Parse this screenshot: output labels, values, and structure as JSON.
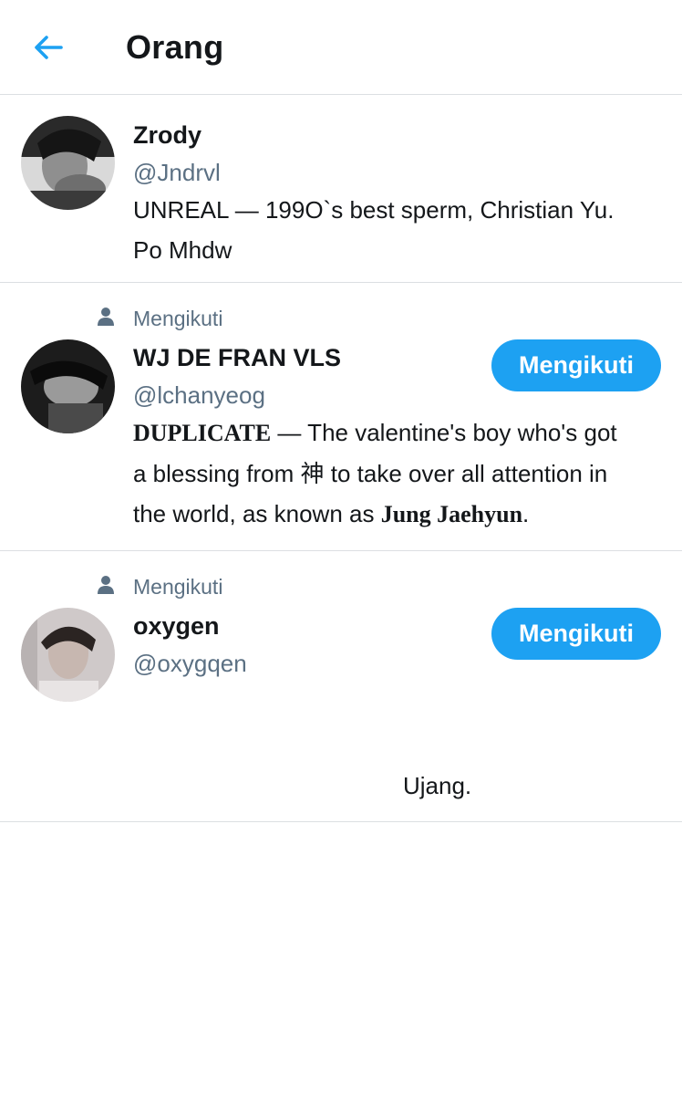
{
  "header": {
    "title": "Orang",
    "back_icon": "arrow-left-icon",
    "accent_color": "#1da1f2"
  },
  "users": [
    {
      "name": "Zrody",
      "handle": "@Jndrvl",
      "bio_line1": "UNREAL — 199O`s best sperm, Christian Yu.",
      "bio_line2": "Po Mhdw"
    },
    {
      "social_context": "Mengikuti",
      "social_icon": "person-icon",
      "name": "WJ DE FRAN VLS",
      "handle": "@lchanyeog",
      "follow_label": "Mengikuti",
      "bio_bold_1": "DUPLICATE",
      "bio_text_1": " — The valentine's boy who's got",
      "bio_line2": "a blessing from 神 to take over all attention in",
      "bio_text_3": "the world, as known as ",
      "bio_bold_3": "Jung Jaehyun",
      "bio_end": "."
    },
    {
      "social_context": "Mengikuti",
      "social_icon": "person-icon",
      "name": "oxygen",
      "handle": "@oxygqen",
      "follow_label": "Mengikuti",
      "bio_line1": "Ujang."
    }
  ]
}
